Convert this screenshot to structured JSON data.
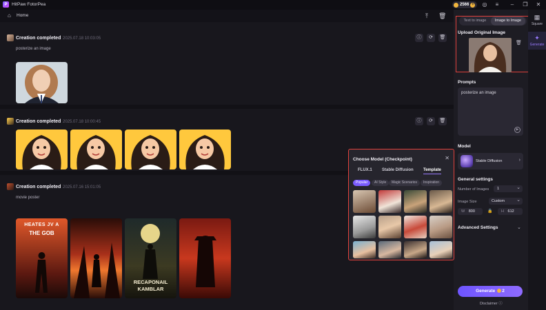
{
  "app": {
    "title": "HitPaw FotorPea",
    "credits": "2566"
  },
  "nav": {
    "home": "Home"
  },
  "feed": {
    "cards": [
      {
        "title": "Creation completed",
        "date": "2025.07.18 10:03:05",
        "prompt": "posterize an image"
      },
      {
        "title": "Creation completed",
        "date": "2025.07.18 10:00:45",
        "prompt": ""
      },
      {
        "title": "Creation completed",
        "date": "2025.07.16 15:01:05",
        "prompt": "movie poster"
      }
    ],
    "posters": [
      {
        "line1": "HEATES JV A",
        "line2": "THE GOB"
      },
      {
        "line1": "",
        "line2": ""
      },
      {
        "line1": "RECAPONAIL",
        "line2": "KAMBLAR"
      },
      {
        "line1": "",
        "line2": ""
      }
    ]
  },
  "right_nav": {
    "square": "Square",
    "generate": "Generate"
  },
  "panel": {
    "mode_tabs": [
      "Text to image",
      "Image to Image"
    ],
    "active_mode": "Image to Image",
    "upload_label": "Upload Original Image",
    "prompts_label": "Prompts",
    "prompt_value": "posterize an image",
    "model_label": "Model",
    "model_name": "Stable Diffusion",
    "general_label": "General settings",
    "num_images_label": "Number of Images",
    "num_images_value": "1",
    "image_size_label": "Image Size",
    "image_size_value": "Custom",
    "width_label": "W",
    "width_value": "800",
    "height_label": "H",
    "height_value": "612",
    "advanced_label": "Advanced Settings",
    "generate_label": "Generate",
    "generate_cost": "2",
    "disclaimer": "Disclaimer"
  },
  "popup": {
    "title": "Choose Model (Checkpoint)",
    "tabs": [
      "FLUX.1",
      "Stable Diffusion",
      "Template"
    ],
    "active_tab": "Template",
    "pills": [
      "Popular",
      "AI Style",
      "Magic Scenarios",
      "Inspiration"
    ],
    "active_pill": "Popular"
  },
  "colors": {
    "accent": "#7a5cff",
    "highlight": "#e2413c",
    "coin": "#f2b63d"
  }
}
